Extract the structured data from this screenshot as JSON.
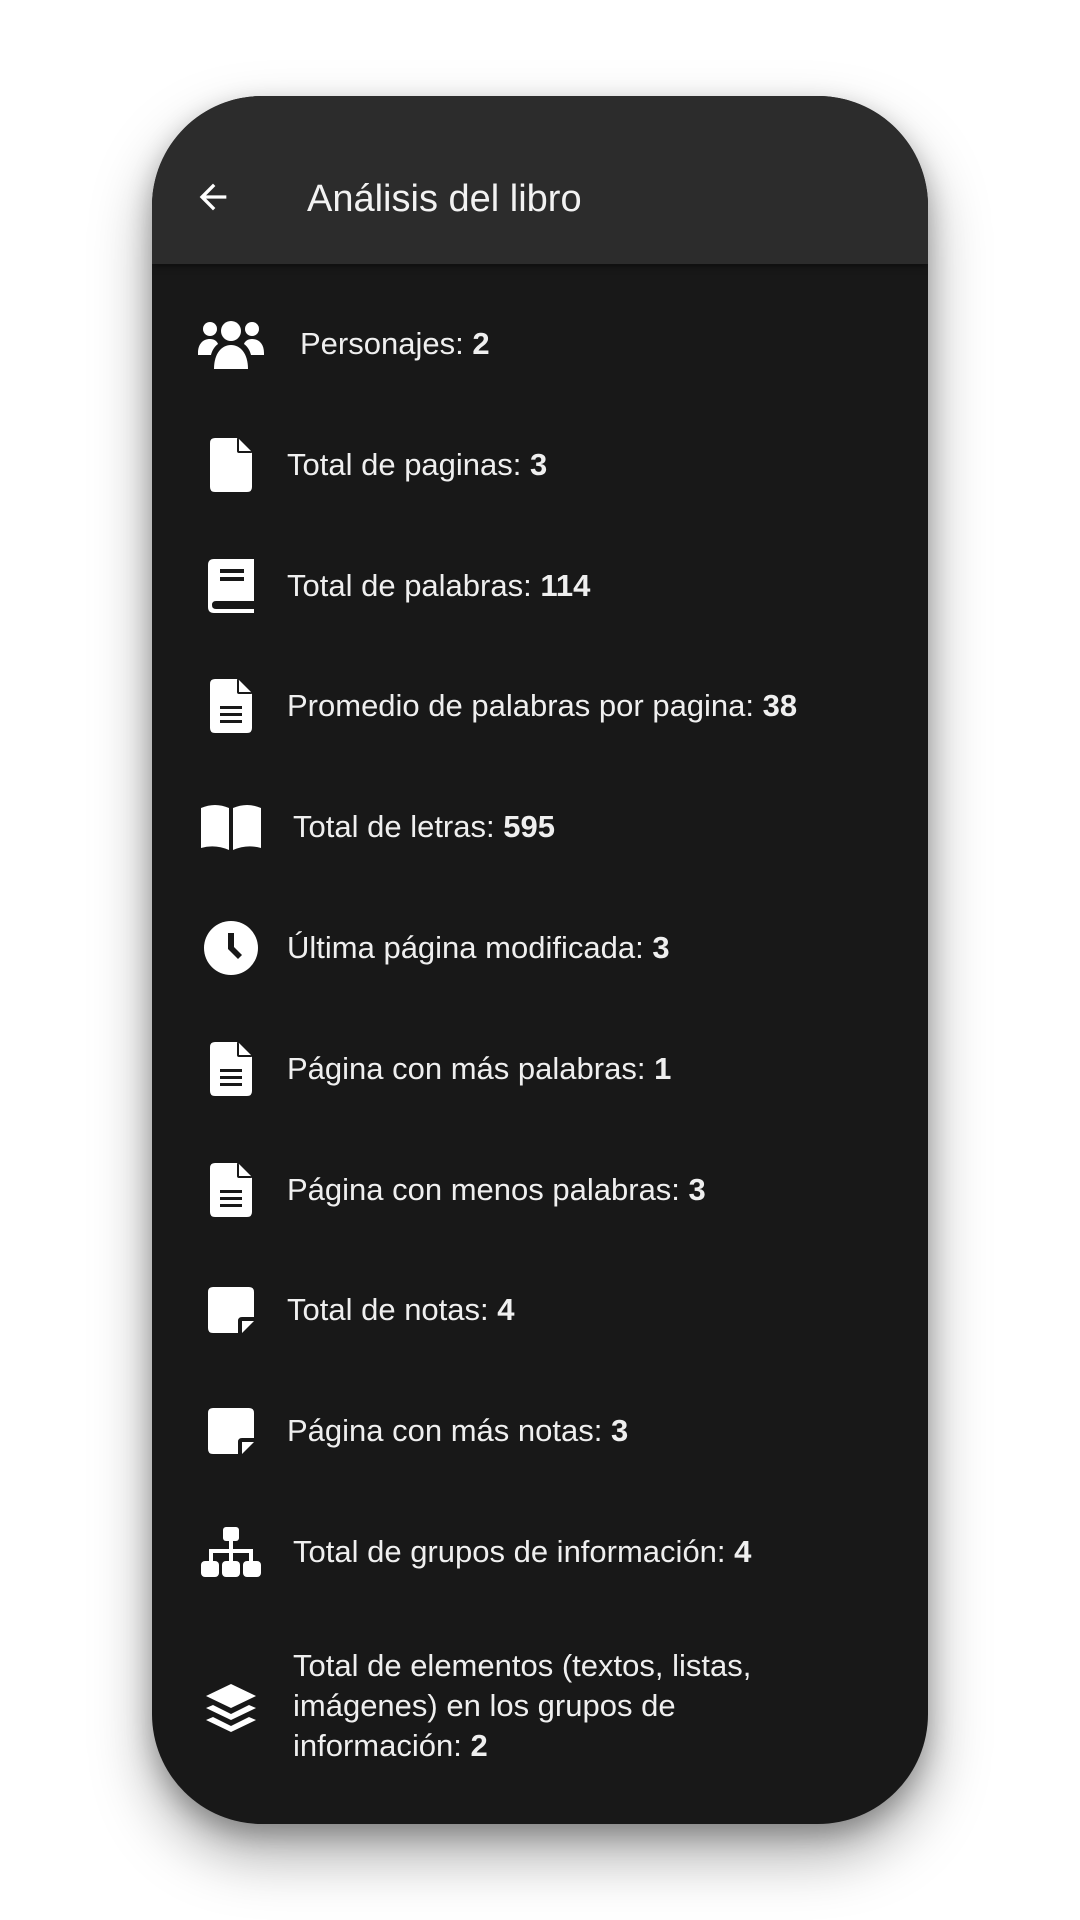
{
  "header": {
    "title": "Análisis del libro"
  },
  "stats": [
    {
      "label": "Personajes:",
      "value": "2",
      "icon": "users-icon"
    },
    {
      "label": "Total de paginas:",
      "value": "3",
      "icon": "file-icon"
    },
    {
      "label": "Total de palabras:",
      "value": "114",
      "icon": "book-icon"
    },
    {
      "label": "Promedio de palabras por pagina:",
      "value": "38",
      "icon": "file-text-icon"
    },
    {
      "label": "Total de letras:",
      "value": "595",
      "icon": "book-open-icon"
    },
    {
      "label": "Última página modificada:",
      "value": "3",
      "icon": "clock-icon"
    },
    {
      "label": "Página con más palabras:",
      "value": "1",
      "icon": "file-text-icon"
    },
    {
      "label": "Página con menos palabras:",
      "value": "3",
      "icon": "file-text-icon"
    },
    {
      "label": "Total de notas:",
      "value": "4",
      "icon": "sticky-note-icon"
    },
    {
      "label": "Página con más notas:",
      "value": "3",
      "icon": "sticky-note-icon"
    },
    {
      "label": "Total de grupos de información:",
      "value": "4",
      "icon": "sitemap-icon"
    },
    {
      "label": "Total de elementos (textos, listas, imágenes) en los grupos de información:",
      "value": "2",
      "icon": "layers-icon"
    }
  ]
}
